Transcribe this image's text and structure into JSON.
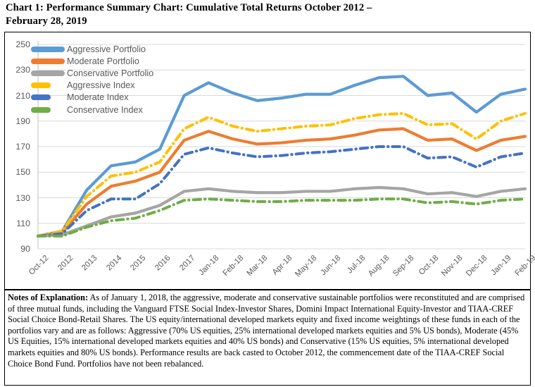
{
  "title": {
    "line1": "Chart 1:  Performance Summary Chart:  Cumulative Total Returns October 2012 –",
    "line2": "February 28, 2019"
  },
  "notes": {
    "heading": "Notes of Explanation:",
    "body": "  As of January 1, 2018, the aggressive, moderate and conservative sustainable portfolios were reconstituted and are comprised of three mutual funds, including the Vanguard FTSE Social Index-Investor Shares, Domini Impact International Equity-Investor and TIAA-CREF Social Choice Bond-Retail Shares. The US equity/international developed markets equity and fixed income weightings of these funds in each of the portfolios vary and are as follows:  Aggressive (70% US equities, 25% international developed markets equities and 5% US bonds), Moderate (45% US Equities, 15% international developed markets equities and 40% US bonds) and Conservative (15% US equities, 5% international developed markets equities and 80% US bonds).  Performance results are back casted to October 2012, the commencement date of the TIAA-CREF Social Choice Bond Fund.  Portfolios have not been rebalanced."
  },
  "chart_data": {
    "type": "line",
    "title": "Chart 1:  Performance Summary Chart:  Cumulative Total Returns October 2012 – February 28, 2019",
    "xlabel": "",
    "ylabel": "",
    "ylim": [
      90,
      250
    ],
    "ytick_step": 20,
    "yticks": [
      90,
      110,
      130,
      150,
      170,
      190,
      210,
      230,
      250
    ],
    "grid": "horizontal",
    "legend_position": "top-left-inside",
    "categories": [
      "Oct-12",
      "2012",
      "2013",
      "2014",
      "2015",
      "2016",
      "2017",
      "Jan-18",
      "Feb-18",
      "Mar-18",
      "Apr-18",
      "May-18",
      "Jun-18",
      "Jul-18",
      "Aug-18",
      "Sep-18",
      "Oct-18",
      "Nov-18",
      "Dec-18",
      "Jan-19",
      "Feb-19"
    ],
    "series": [
      {
        "name": "Aggressive Portfolio",
        "color": "#5B9BD5",
        "style": "solid",
        "values": [
          100,
          104,
          136,
          155,
          158,
          168,
          210,
          220,
          212,
          206,
          208,
          211,
          211,
          218,
          224,
          225,
          210,
          212,
          197,
          211,
          215
        ]
      },
      {
        "name": "Moderate Portfolio",
        "color": "#ED7D31",
        "style": "solid",
        "values": [
          100,
          103,
          125,
          139,
          143,
          150,
          175,
          182,
          176,
          172,
          173,
          175,
          176,
          179,
          183,
          184,
          175,
          176,
          167,
          175,
          178
        ]
      },
      {
        "name": "Conservative Portfolio",
        "color": "#A5A5A5",
        "style": "solid",
        "values": [
          100,
          101,
          108,
          115,
          118,
          124,
          135,
          137,
          135,
          134,
          134,
          135,
          135,
          137,
          138,
          137,
          133,
          134,
          131,
          135,
          137
        ]
      },
      {
        "name": "Aggressive Index",
        "color": "#FFC000",
        "style": "dashdot",
        "values": [
          100,
          104,
          131,
          147,
          150,
          158,
          184,
          193,
          186,
          182,
          184,
          186,
          187,
          192,
          195,
          196,
          187,
          188,
          176,
          190,
          196
        ]
      },
      {
        "name": "Moderate Index",
        "color": "#4472C4",
        "style": "dashdot",
        "values": [
          100,
          102,
          120,
          129,
          129,
          141,
          164,
          169,
          165,
          162,
          163,
          165,
          166,
          168,
          170,
          170,
          161,
          162,
          154,
          162,
          165
        ]
      },
      {
        "name": "Conservative Index",
        "color": "#70AD47",
        "style": "dashdot",
        "values": [
          100,
          100,
          107,
          112,
          114,
          120,
          128,
          129,
          128,
          127,
          127,
          128,
          128,
          128,
          129,
          129,
          126,
          127,
          125,
          128,
          129
        ]
      }
    ]
  }
}
